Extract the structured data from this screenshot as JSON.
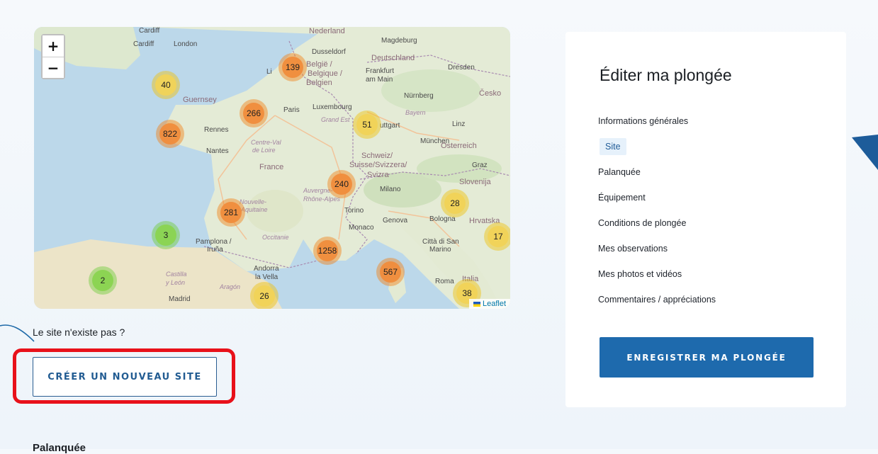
{
  "map": {
    "zoom_in": "+",
    "zoom_out": "−",
    "attribution": "Leaflet",
    "labels": {
      "nederland": "Nederland",
      "magdeburg": "Magdeburg",
      "cardiff": "Cardiff",
      "london": "London",
      "dusseldorf": "Dusseldorf",
      "deutschland": "Deutschland",
      "belgie": "België /",
      "belgique": "Belgique /",
      "belgien": "Belgien",
      "lille": "Li",
      "frankfurt": "Frankfurt",
      "am_main": "am Main",
      "dresden": "Dresden",
      "cesko": "Česko",
      "guernsey": "Guernsey",
      "nurnberg": "Nürnberg",
      "luxembourg": "Luxembourg",
      "paris": "Paris",
      "grand_est": "Grand Est",
      "bayern": "Bayern",
      "stuttgart": "uttgart",
      "linz": "Linz",
      "rennes": "Rennes",
      "munchen": "München",
      "osterreich": "Österreich",
      "nantes": "Nantes",
      "centre_val": "Centre-Val",
      "de_loire": "de Loire",
      "schweiz": "Schweiz/",
      "suisse": "Suisse/Svizzera/",
      "svizra": "Svizra",
      "graz": "Graz",
      "france": "France",
      "slovenija": "Slovenija",
      "auvergne": "Auvergne-",
      "rhone_alpes": "Rhône-Alpes",
      "milano": "Milano",
      "nouvelle": "Nouvelle-",
      "aquitaine": "Aquitaine",
      "torino": "Torino",
      "genova": "Genova",
      "bologna": "Bologna",
      "hrvatska": "Hrvatska",
      "monaco": "Monaco",
      "occitanie": "Occitanie",
      "pamplona": "Pamplona /",
      "irunea": "Iruña",
      "citta_san": "Città di San",
      "marino": "Marino",
      "andorra": "Andorra",
      "la_vella": "la Vella",
      "castilla": "Castilla",
      "y_leon": "y León",
      "aragon": "Aragón",
      "roma": "Roma",
      "italia": "Italia",
      "madrid": "Madrid"
    },
    "clusters": [
      {
        "count": "139",
        "size": "large"
      },
      {
        "count": "40",
        "size": "medium"
      },
      {
        "count": "266",
        "size": "large"
      },
      {
        "count": "51",
        "size": "medium"
      },
      {
        "count": "822",
        "size": "large"
      },
      {
        "count": "240",
        "size": "large"
      },
      {
        "count": "28",
        "size": "medium"
      },
      {
        "count": "281",
        "size": "large"
      },
      {
        "count": "17",
        "size": "medium"
      },
      {
        "count": "3",
        "size": "small"
      },
      {
        "count": "1258",
        "size": "large"
      },
      {
        "count": "567",
        "size": "large"
      },
      {
        "count": "2",
        "size": "small"
      },
      {
        "count": "26",
        "size": "medium"
      },
      {
        "count": "38",
        "size": "medium"
      }
    ]
  },
  "site_missing_text": "Le site n'existe pas ?",
  "create_site_button": "CRÉER UN NOUVEAU SITE",
  "next_section_title": "Palanquée",
  "sidebar": {
    "title": "Éditer ma plongée",
    "items": [
      {
        "label": "Informations générales"
      },
      {
        "label": "Site"
      },
      {
        "label": "Palanquée"
      },
      {
        "label": "Équipement"
      },
      {
        "label": "Conditions de plongée"
      },
      {
        "label": "Mes observations"
      },
      {
        "label": "Mes photos et vidéos"
      },
      {
        "label": "Commentaires / appréciations"
      }
    ],
    "active_item": "Site",
    "save_button": "ENREGISTRER MA PLONGÉE"
  },
  "colors": {
    "primary": "#1e6aad",
    "highlight": "#e8111a",
    "cluster_large": "#f08c3c",
    "cluster_medium": "#f1d357",
    "cluster_small": "#8ad450"
  }
}
